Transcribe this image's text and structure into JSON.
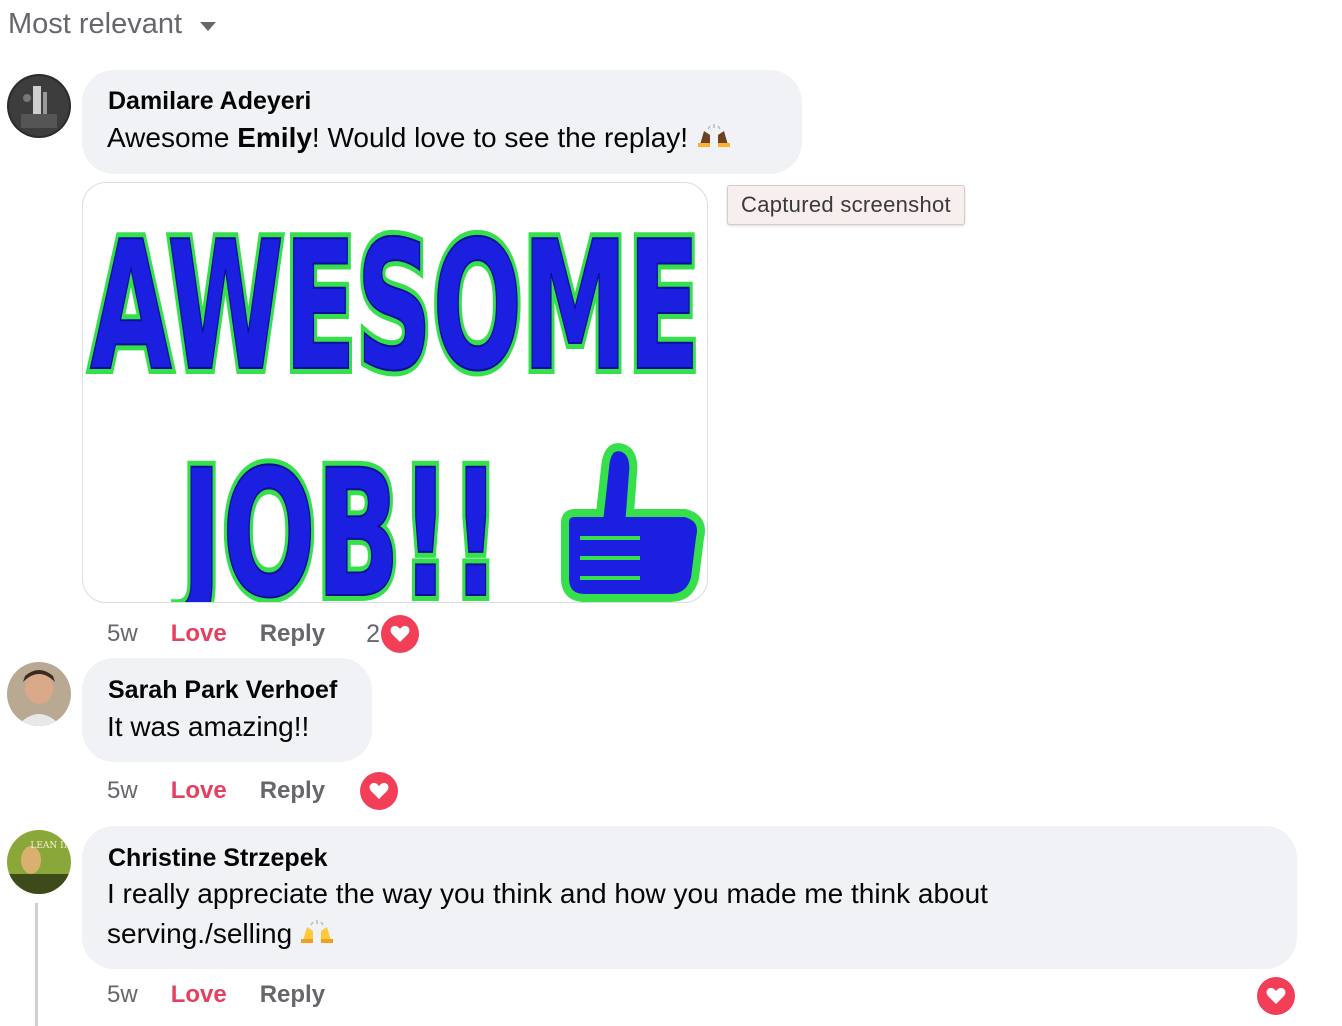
{
  "sort": {
    "label": "Most relevant"
  },
  "tooltip": {
    "text": "Captured screenshot"
  },
  "comments": [
    {
      "author": "Damilare Adeyeri",
      "text_before": "Awesome ",
      "text_mention": "Emily",
      "text_after": "! Would love to see the replay! ",
      "emoji_icon": "raised-hands-dark-emoji",
      "gif": {
        "line1": "AWESOME",
        "line2": "JOB!!"
      },
      "time": "5w",
      "love": "Love",
      "reply": "Reply",
      "reaction_count": "2",
      "reaction_icon": "heart-icon"
    },
    {
      "author": "Sarah Park Verhoef",
      "text": "It was amazing!!",
      "time": "5w",
      "love": "Love",
      "reply": "Reply",
      "reaction_icon": "heart-icon"
    },
    {
      "author": "Christine Strzepek",
      "text_line1": "I really appreciate the way you think and how you made me think about",
      "text_line2": "serving./selling ",
      "emoji_icon": "raised-hands-emoji",
      "avatar_text": "LEAN IN",
      "time": "5w",
      "love": "Love",
      "reply": "Reply",
      "reaction_icon": "heart-icon"
    }
  ],
  "colors": {
    "bubble": "#f0f2f5",
    "love": "#e4405f",
    "heart": "#f33e58",
    "gif_text": "#1a1fe0",
    "gif_glow": "#35e04a"
  }
}
